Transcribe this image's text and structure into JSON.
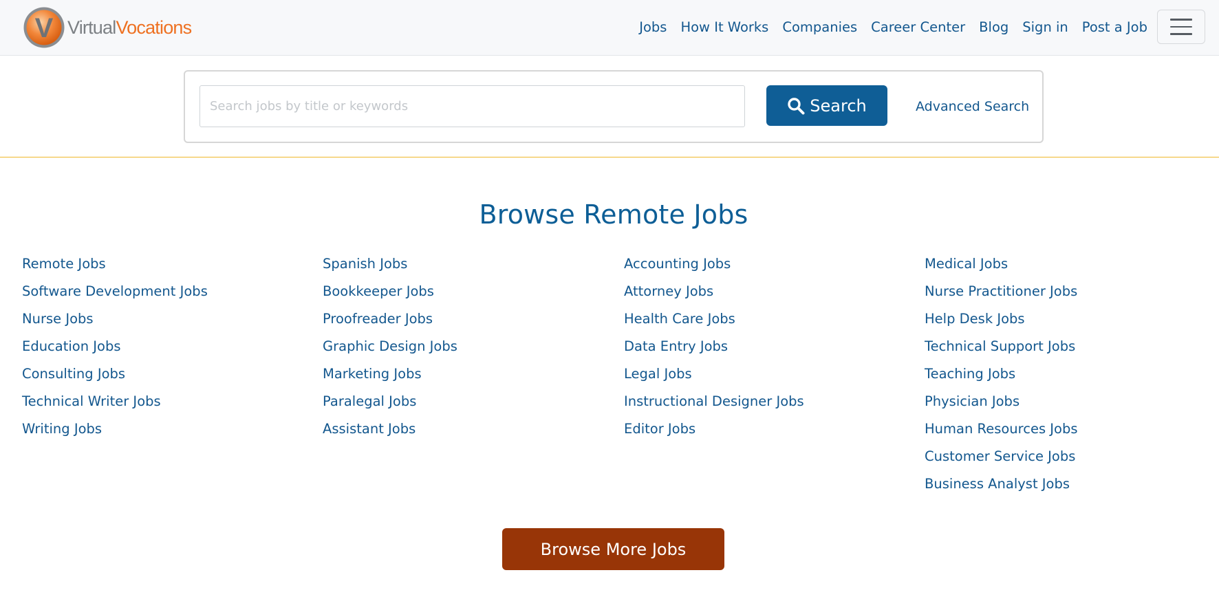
{
  "header": {
    "logo": {
      "letter": "V",
      "word1": "Virtual",
      "word2": "Vocations"
    },
    "nav": [
      "Jobs",
      "How It Works",
      "Companies",
      "Career Center",
      "Blog",
      "Sign in",
      "Post a Job"
    ]
  },
  "search": {
    "placeholder": "Search jobs by title or keywords",
    "value": "",
    "button_label": "Search",
    "advanced_label": "Advanced Search"
  },
  "browse": {
    "title": "Browse Remote Jobs",
    "columns": [
      [
        "Remote Jobs",
        "Software Development Jobs",
        "Nurse Jobs",
        "Education Jobs",
        "Consulting Jobs",
        "Technical Writer Jobs",
        "Writing Jobs"
      ],
      [
        "Spanish Jobs",
        "Bookkeeper Jobs",
        "Proofreader Jobs",
        "Graphic Design Jobs",
        "Marketing Jobs",
        "Paralegal Jobs",
        "Assistant Jobs"
      ],
      [
        "Accounting Jobs",
        "Attorney Jobs",
        "Health Care Jobs",
        "Data Entry Jobs",
        "Legal Jobs",
        "Instructional Designer Jobs",
        "Editor Jobs"
      ],
      [
        "Medical Jobs",
        "Nurse Practitioner Jobs",
        "Help Desk Jobs",
        "Technical Support Jobs",
        "Teaching Jobs",
        "Physician Jobs",
        "Human Resources Jobs",
        "Customer Service Jobs",
        "Business Analyst Jobs"
      ]
    ],
    "more_label": "Browse More Jobs"
  },
  "icons": {
    "search": "search-icon",
    "menu": "hamburger-menu-icon",
    "logo": "virtual-vocations-logo-icon"
  },
  "colors": {
    "link": "#13578e",
    "title": "#0d5e96",
    "search_button": "#0f5e96",
    "browse_more_button": "#983507",
    "logo_orange": "#ee7122",
    "logo_gray": "#7c8084",
    "divider": "#f0b72a"
  }
}
